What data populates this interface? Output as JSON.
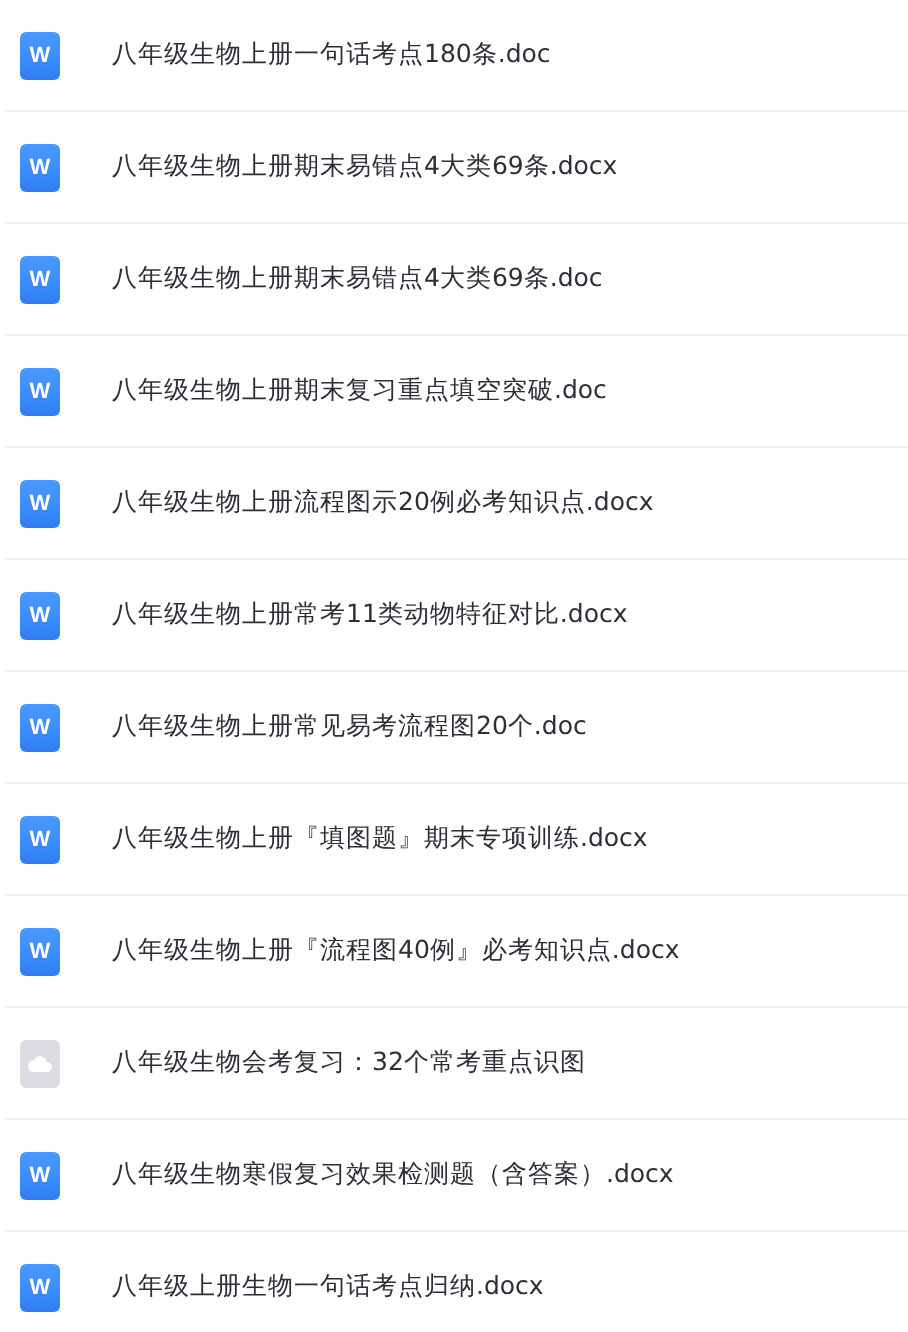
{
  "files": [
    {
      "kind": "doc",
      "badge": "W",
      "name": "八年级生物上册一句话考点180条.doc"
    },
    {
      "kind": "doc",
      "badge": "W",
      "name": "八年级生物上册期末易错点4大类69条.docx"
    },
    {
      "kind": "doc",
      "badge": "W",
      "name": "八年级生物上册期末易错点4大类69条.doc"
    },
    {
      "kind": "doc",
      "badge": "W",
      "name": "八年级生物上册期末复习重点填空突破.doc"
    },
    {
      "kind": "doc",
      "badge": "W",
      "name": "八年级生物上册流程图示20例必考知识点.docx"
    },
    {
      "kind": "doc",
      "badge": "W",
      "name": "八年级生物上册常考11类动物特征对比.docx"
    },
    {
      "kind": "doc",
      "badge": "W",
      "name": "八年级生物上册常见易考流程图20个.doc"
    },
    {
      "kind": "doc",
      "badge": "W",
      "name": "八年级生物上册『填图题』期末专项训练.docx"
    },
    {
      "kind": "doc",
      "badge": "W",
      "name": "八年级生物上册『流程图40例』必考知识点.docx"
    },
    {
      "kind": "cloud",
      "name": "八年级生物会考复习：32个常考重点识图"
    },
    {
      "kind": "doc",
      "badge": "W",
      "name": "八年级生物寒假复习效果检测题（含答案）.docx"
    },
    {
      "kind": "doc",
      "badge": "W",
      "name": "八年级上册生物一句话考点归纳.docx"
    }
  ]
}
